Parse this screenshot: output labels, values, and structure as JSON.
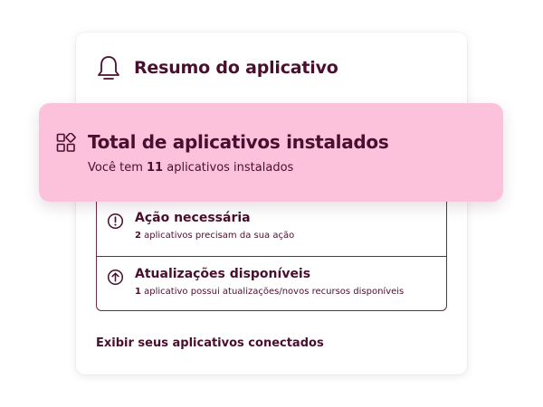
{
  "card": {
    "title": "Resumo do aplicativo",
    "footer_link": "Exibir seus aplicativos conectados"
  },
  "banner": {
    "title": "Total de aplicativos instalados",
    "subtitle_prefix": "Você tem ",
    "count": "11",
    "subtitle_suffix": " aplicativos instalados"
  },
  "items": [
    {
      "title": "Ação necessária",
      "count": "2",
      "desc": " aplicativos precisam da sua ação",
      "icon": "exclamation-circle-icon"
    },
    {
      "title": "Atualizações disponíveis",
      "count": "1",
      "desc": " aplicativo possui atualizações/novos recursos disponíveis",
      "icon": "arrow-up-circle-icon"
    }
  ],
  "colors": {
    "text": "#4a0f2e",
    "banner_bg": "#fcc2dc",
    "border": "#6a2b48"
  }
}
